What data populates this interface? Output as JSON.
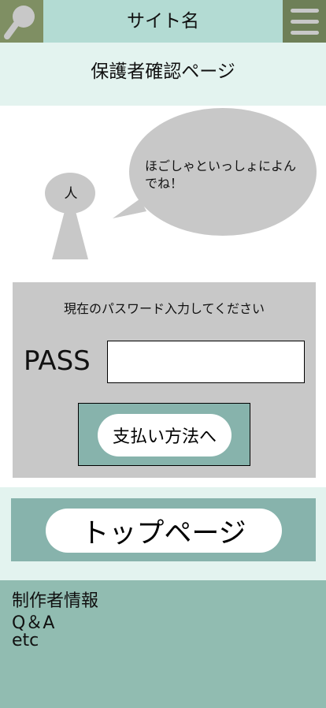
{
  "header": {
    "site_name": "サイト名",
    "search_icon": "search-icon",
    "menu_icon": "menu-icon"
  },
  "page": {
    "title": "保護者確認ページ"
  },
  "illustration": {
    "person_label": "人",
    "bubble_text": "ほごしゃといっしょによんでね！"
  },
  "form": {
    "prompt": "現在のパスワード入力してください",
    "pass_label": "PASS",
    "pass_value": "",
    "pay_button": "支払い方法へ"
  },
  "nav": {
    "top_page_button": "トップページ"
  },
  "footer": {
    "lines": [
      "制作者情報",
      "Q＆A",
      "etc"
    ]
  },
  "colors": {
    "header_bg": "#b3dbd3",
    "search_bg": "#7f8f63",
    "menu_bg": "#6e7f57",
    "accent_teal": "#87b3ac",
    "footer_bg": "#91bcb1",
    "page_bg": "#e3f3ef",
    "form_bg": "#c8c8c8"
  }
}
